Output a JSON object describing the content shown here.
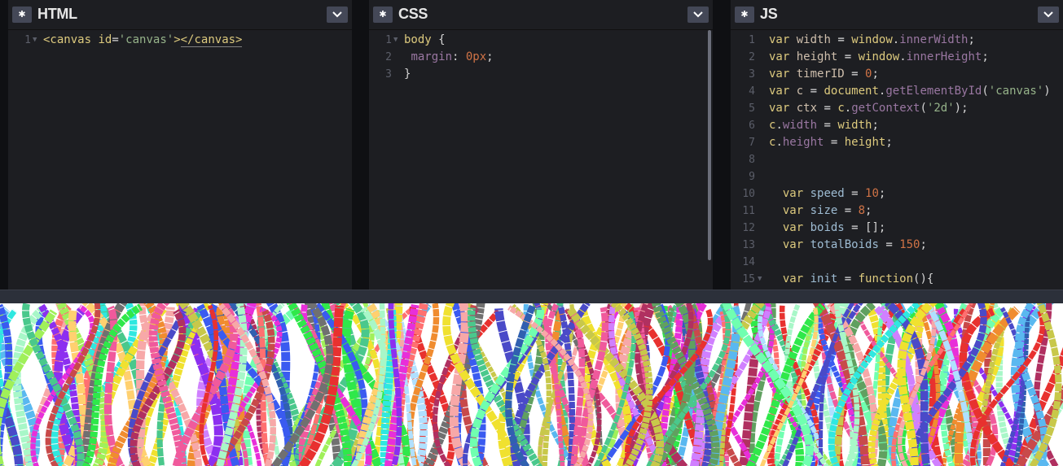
{
  "panes": {
    "html": {
      "title": "HTML",
      "lines": [
        {
          "n": "1",
          "fold": true,
          "tokens": [
            [
              "t-tag",
              "<canvas"
            ],
            [
              "t-punct",
              " "
            ],
            [
              "t-attr",
              "id"
            ],
            [
              "t-punct",
              "="
            ],
            [
              "t-str",
              "'canvas'"
            ],
            [
              "t-tag",
              ">"
            ],
            [
              "t-tag t-ul",
              "</canvas>"
            ]
          ]
        }
      ]
    },
    "css": {
      "title": "CSS",
      "lines": [
        {
          "n": "1",
          "fold": true,
          "tokens": [
            [
              "t-kw",
              "body"
            ],
            [
              "t-punct",
              " {"
            ]
          ]
        },
        {
          "n": "2",
          "fold": false,
          "tokens": [
            [
              "t-punct",
              " "
            ],
            [
              "t-prop",
              "margin"
            ],
            [
              "t-punct",
              ": "
            ],
            [
              "t-num",
              "0px"
            ],
            [
              "t-punct",
              ";"
            ]
          ]
        },
        {
          "n": "3",
          "fold": false,
          "tokens": [
            [
              "t-punct",
              "}"
            ]
          ]
        }
      ]
    },
    "js": {
      "title": "JS",
      "lines": [
        {
          "n": "1",
          "fold": false,
          "tokens": [
            [
              "t-kw",
              "var"
            ],
            [
              "t-punct",
              " "
            ],
            [
              "t-def",
              "width"
            ],
            [
              "t-op",
              " = "
            ],
            [
              "t-kw",
              "window"
            ],
            [
              "t-punct",
              "."
            ],
            [
              "t-prop",
              "innerWidth"
            ],
            [
              "t-punct",
              ";"
            ]
          ]
        },
        {
          "n": "2",
          "fold": false,
          "tokens": [
            [
              "t-kw",
              "var"
            ],
            [
              "t-punct",
              " "
            ],
            [
              "t-def",
              "height"
            ],
            [
              "t-op",
              " = "
            ],
            [
              "t-kw",
              "window"
            ],
            [
              "t-punct",
              "."
            ],
            [
              "t-prop",
              "innerHeight"
            ],
            [
              "t-punct",
              ";"
            ]
          ]
        },
        {
          "n": "3",
          "fold": false,
          "tokens": [
            [
              "t-kw",
              "var"
            ],
            [
              "t-punct",
              " "
            ],
            [
              "t-def",
              "timerID"
            ],
            [
              "t-op",
              " = "
            ],
            [
              "t-num",
              "0"
            ],
            [
              "t-punct",
              ";"
            ]
          ]
        },
        {
          "n": "4",
          "fold": false,
          "tokens": [
            [
              "t-kw",
              "var"
            ],
            [
              "t-punct",
              " "
            ],
            [
              "t-def",
              "c"
            ],
            [
              "t-op",
              " = "
            ],
            [
              "t-kw",
              "document"
            ],
            [
              "t-punct",
              "."
            ],
            [
              "t-prop",
              "getElementById"
            ],
            [
              "t-punct",
              "("
            ],
            [
              "t-str",
              "'canvas'"
            ],
            [
              "t-punct",
              ")"
            ]
          ]
        },
        {
          "n": "5",
          "fold": false,
          "tokens": [
            [
              "t-kw",
              "var"
            ],
            [
              "t-punct",
              " "
            ],
            [
              "t-def",
              "ctx"
            ],
            [
              "t-op",
              " = "
            ],
            [
              "t-kw",
              "c"
            ],
            [
              "t-punct",
              "."
            ],
            [
              "t-prop",
              "getContext"
            ],
            [
              "t-punct",
              "("
            ],
            [
              "t-str",
              "'2d'"
            ],
            [
              "t-punct",
              ");"
            ]
          ]
        },
        {
          "n": "6",
          "fold": false,
          "tokens": [
            [
              "t-kw",
              "c"
            ],
            [
              "t-punct",
              "."
            ],
            [
              "t-prop",
              "width"
            ],
            [
              "t-op",
              " = "
            ],
            [
              "t-kw",
              "width"
            ],
            [
              "t-punct",
              ";"
            ]
          ]
        },
        {
          "n": "7",
          "fold": false,
          "tokens": [
            [
              "t-kw",
              "c"
            ],
            [
              "t-punct",
              "."
            ],
            [
              "t-prop",
              "height"
            ],
            [
              "t-op",
              " = "
            ],
            [
              "t-kw",
              "height"
            ],
            [
              "t-punct",
              ";"
            ]
          ]
        },
        {
          "n": "8",
          "fold": false,
          "tokens": []
        },
        {
          "n": "9",
          "fold": false,
          "tokens": []
        },
        {
          "n": "10",
          "fold": false,
          "tokens": [
            [
              "t-punct",
              "  "
            ],
            [
              "t-kw",
              "var"
            ],
            [
              "t-punct",
              " "
            ],
            [
              "t-var",
              "speed"
            ],
            [
              "t-op",
              " = "
            ],
            [
              "t-num",
              "10"
            ],
            [
              "t-punct",
              ";"
            ]
          ]
        },
        {
          "n": "11",
          "fold": false,
          "tokens": [
            [
              "t-punct",
              "  "
            ],
            [
              "t-kw",
              "var"
            ],
            [
              "t-punct",
              " "
            ],
            [
              "t-var",
              "size"
            ],
            [
              "t-op",
              " = "
            ],
            [
              "t-num",
              "8"
            ],
            [
              "t-punct",
              ";"
            ]
          ]
        },
        {
          "n": "12",
          "fold": false,
          "tokens": [
            [
              "t-punct",
              "  "
            ],
            [
              "t-kw",
              "var"
            ],
            [
              "t-punct",
              " "
            ],
            [
              "t-var",
              "boids"
            ],
            [
              "t-op",
              " = "
            ],
            [
              "t-punct",
              "[]"
            ],
            [
              "t-punct",
              ";"
            ]
          ]
        },
        {
          "n": "13",
          "fold": false,
          "tokens": [
            [
              "t-punct",
              "  "
            ],
            [
              "t-kw",
              "var"
            ],
            [
              "t-punct",
              " "
            ],
            [
              "t-var",
              "totalBoids"
            ],
            [
              "t-op",
              " = "
            ],
            [
              "t-num",
              "150"
            ],
            [
              "t-punct",
              ";"
            ]
          ]
        },
        {
          "n": "14",
          "fold": false,
          "tokens": []
        },
        {
          "n": "15",
          "fold": true,
          "tokens": [
            [
              "t-punct",
              "  "
            ],
            [
              "t-kw",
              "var"
            ],
            [
              "t-punct",
              " "
            ],
            [
              "t-var",
              "init"
            ],
            [
              "t-op",
              " = "
            ],
            [
              "t-kw",
              "function"
            ],
            [
              "t-punct",
              "(){"
            ]
          ]
        }
      ]
    }
  },
  "icons": {
    "settings": "gear-icon",
    "collapse": "chevron-down-icon"
  },
  "preview": {
    "background": "#ffffff",
    "palette": [
      "#e8312f",
      "#2fe84a",
      "#3a5bf0",
      "#f0e12f",
      "#e82fd9",
      "#2fe8e0",
      "#f08c2f",
      "#8c2ff0",
      "#a0f05a",
      "#f05a9c",
      "#5ab8f0",
      "#c8c84a",
      "#4ac88c",
      "#c84a4a",
      "#4a4ac8",
      "#f7a8a8",
      "#a8f7c8",
      "#b0e0ff",
      "#ffd070",
      "#d080ff",
      "#70ffb0",
      "#ff7070",
      "#707070",
      "#60a060",
      "#b03060",
      "#3060b0"
    ]
  },
  "colors": {
    "accent": "#444857",
    "editor_bg": "#1d1e22",
    "gutter_text": "#5b5e69"
  }
}
